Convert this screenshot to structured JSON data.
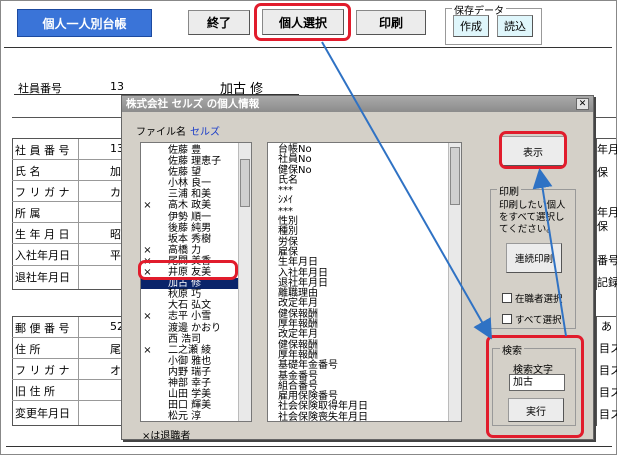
{
  "toolbar": {
    "title_button": "個人一人別台帳",
    "end": "終了",
    "select": "個人選択",
    "print": "印刷",
    "save_group": "保存データ",
    "create": "作成",
    "read": "読込"
  },
  "header": {
    "emp_no_label": "社員番号",
    "emp_no": "13",
    "emp_name": "加古 修"
  },
  "bg_left": {
    "rows": [
      "社 員 番 号",
      "氏 名",
      "フ リ ガ ナ",
      "所 属",
      "生 年 月 日",
      "入社年月日",
      "退社年月日"
    ],
    "values": [
      "13",
      "加",
      "カ",
      "",
      "昭",
      "平",
      ""
    ]
  },
  "bg_left2": {
    "rows": [
      "郵 便 番 号",
      "住 所",
      "フ リ ガ ナ",
      "旧 住 所",
      "変更年月日"
    ],
    "values": [
      "52",
      "尾",
      "オ",
      "",
      ""
    ]
  },
  "bg_right": {
    "a": [
      "年月",
      "保",
      "年月",
      "保",
      "番号",
      "記録"
    ],
    "b": [
      "あ",
      "目ス",
      "目ス",
      "目ス",
      "目ス"
    ]
  },
  "dialog": {
    "title": "株式会社 セルズ の個人情報",
    "filename_label": "ファイル名",
    "filename": "セルズ",
    "employees": [
      {
        "mark": "",
        "name": "佐藤 豊"
      },
      {
        "mark": "",
        "name": "佐藤 理恵子"
      },
      {
        "mark": "",
        "name": "佐藤 望"
      },
      {
        "mark": "",
        "name": "小林 良一"
      },
      {
        "mark": "",
        "name": "三浦 和美"
      },
      {
        "mark": "×",
        "name": "高木 政美"
      },
      {
        "mark": "",
        "name": "伊勢 順一"
      },
      {
        "mark": "",
        "name": "後藤 純男"
      },
      {
        "mark": "",
        "name": "坂本 秀樹"
      },
      {
        "mark": "×",
        "name": "高橋 力"
      },
      {
        "mark": "×",
        "name": "尾関 美香"
      },
      {
        "mark": "×",
        "name": "井原 友美"
      },
      {
        "mark": "",
        "name": "加古 修"
      },
      {
        "mark": "",
        "name": "秋原 巧"
      },
      {
        "mark": "",
        "name": "大石 弘文"
      },
      {
        "mark": "×",
        "name": "志平 小雪"
      },
      {
        "mark": "",
        "name": "渡邊 かおり"
      },
      {
        "mark": "",
        "name": "西 浩司"
      },
      {
        "mark": "×",
        "name": "二之瀬 綾"
      },
      {
        "mark": "",
        "name": "小御 雅也"
      },
      {
        "mark": "",
        "name": "内野 瑞子"
      },
      {
        "mark": "",
        "name": "神部 幸子"
      },
      {
        "mark": "",
        "name": "山田 学美"
      },
      {
        "mark": "",
        "name": "田口 輝美"
      },
      {
        "mark": "",
        "name": "松元 淳"
      },
      {
        "mark": "",
        "name": "加藤 晃"
      }
    ],
    "fields": [
      "台帳No",
      "社員No",
      "健保No",
      "氏名",
      "***",
      "ｼﾒｲ",
      "***",
      "性別",
      "種別",
      "労保",
      "雇保",
      "生年月日",
      "入社年月日",
      "退社年月日",
      "離職理由",
      "改定年月",
      "健保報酬",
      "厚年報酬",
      "改定年月",
      "健保報酬",
      "厚年報酬",
      "基礎年金番号",
      "基金番号",
      "組合番号",
      "雇用保険番号",
      "社会保険取得年月日",
      "社会保険喪失年月日"
    ],
    "retired_note": "×は退職者",
    "show_button": "表示",
    "print_group": "印刷",
    "print_note": "印刷したい個人をすべて選択してください。",
    "batch_print": "連続印刷",
    "incumbent": "在職者選択",
    "select_all": "すべて選択",
    "search_group": "検索",
    "search_label": "検索文字",
    "search_value": "加古",
    "search_button": "実行"
  },
  "colors": {
    "red": "#e11c2c",
    "blue_arrow": "#2f72c4",
    "title_blue": "#3a74d8",
    "selection": "#0a246a"
  }
}
